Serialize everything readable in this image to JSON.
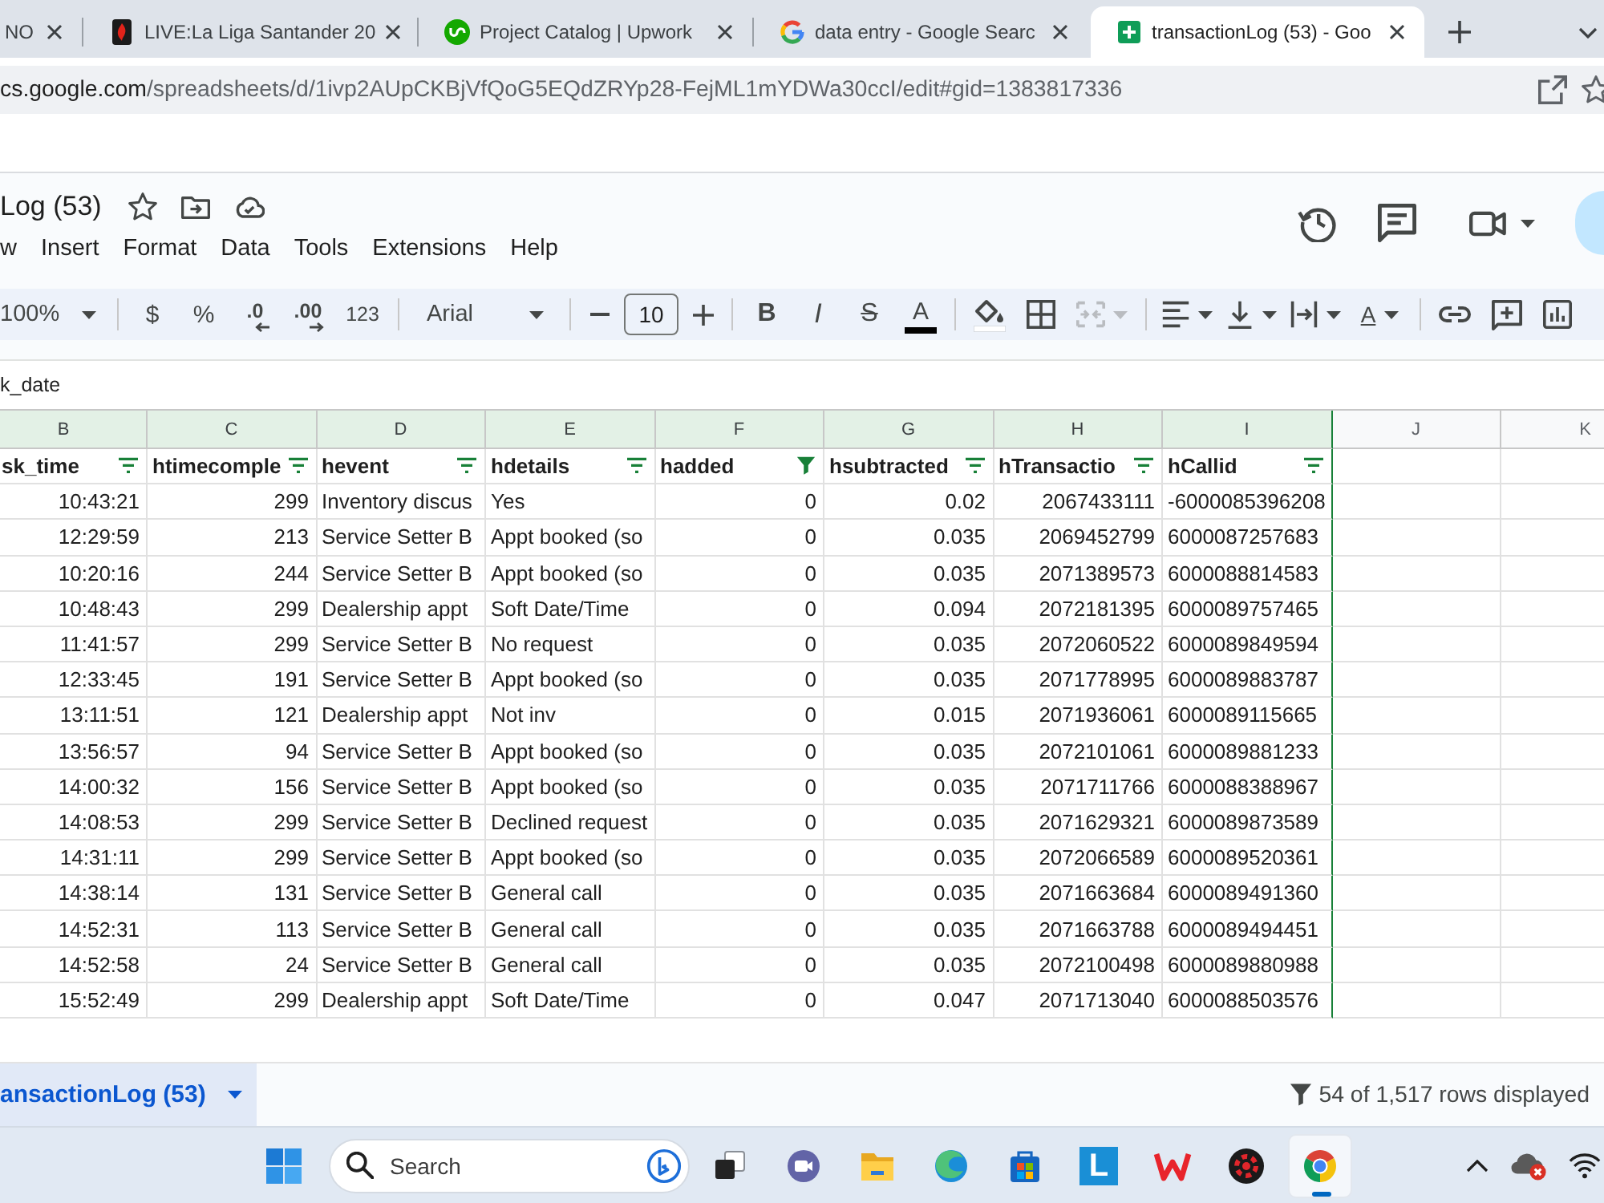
{
  "browser": {
    "tabs": [
      {
        "title": "NO",
        "selected": false
      },
      {
        "title": "LIVE:La Liga Santander 20",
        "selected": false
      },
      {
        "title": "Project Catalog | Upwork",
        "selected": false
      },
      {
        "title": "data entry - Google Searc",
        "selected": false
      },
      {
        "title": "transactionLog (53) - Goo",
        "selected": true
      }
    ],
    "url": {
      "host": "cs.google.com",
      "path": "/spreadsheets/d/1ivp2AUpCKBjVfQoG5EQdZRYp28-FejML1mYDWa30ccI/edit#gid=1383817336"
    }
  },
  "document": {
    "title": "Log (53)",
    "menu": [
      "w",
      "Insert",
      "Format",
      "Data",
      "Tools",
      "Extensions",
      "Help"
    ]
  },
  "toolbar": {
    "zoom": "100%",
    "currency": "$",
    "percent": "%",
    "decrease_decimals": ".0",
    "increase_decimals": ".00",
    "number_format": "123",
    "font": "Arial",
    "font_size": "10",
    "bold": "B",
    "italic": "I",
    "strikethrough": "S",
    "text_color": "A",
    "merge_disabled": true,
    "text_rotation": "A"
  },
  "formula_bar": {
    "value": "k_date"
  },
  "grid": {
    "columns": [
      {
        "letter": "B",
        "filtered": true,
        "heading": "sk_time",
        "filter_active": false,
        "numeric": true
      },
      {
        "letter": "C",
        "filtered": true,
        "heading": "htimecomple",
        "filter_active": false,
        "numeric": true
      },
      {
        "letter": "D",
        "filtered": true,
        "heading": "hevent",
        "filter_active": false,
        "numeric": false
      },
      {
        "letter": "E",
        "filtered": true,
        "heading": "hdetails",
        "filter_active": false,
        "numeric": false
      },
      {
        "letter": "F",
        "filtered": true,
        "heading": "hadded",
        "filter_active": true,
        "numeric": true
      },
      {
        "letter": "G",
        "filtered": true,
        "heading": "hsubtracted",
        "filter_active": false,
        "numeric": true
      },
      {
        "letter": "H",
        "filtered": true,
        "heading": "hTransactio",
        "filter_active": false,
        "numeric": true
      },
      {
        "letter": "I",
        "filtered": true,
        "heading": "hCallid",
        "filter_active": false,
        "numeric": false
      },
      {
        "letter": "J",
        "filtered": false
      },
      {
        "letter": "K",
        "filtered": false
      }
    ],
    "rows": [
      [
        "10:43:21",
        "299",
        "Inventory discus",
        "Yes",
        "0",
        "0.02",
        "2067433111",
        "-6000085396208"
      ],
      [
        "12:29:59",
        "213",
        "Service Setter B",
        "Appt booked (so",
        "0",
        "0.035",
        "2069452799",
        "6000087257683"
      ],
      [
        "10:20:16",
        "244",
        "Service Setter B",
        "Appt booked (so",
        "0",
        "0.035",
        "2071389573",
        "6000088814583"
      ],
      [
        "10:48:43",
        "299",
        "Dealership appt",
        "Soft Date/Time",
        "0",
        "0.094",
        "2072181395",
        "6000089757465"
      ],
      [
        "11:41:57",
        "299",
        "Service Setter B",
        "No request",
        "0",
        "0.035",
        "2072060522",
        "6000089849594"
      ],
      [
        "12:33:45",
        "191",
        "Service Setter B",
        "Appt booked (so",
        "0",
        "0.035",
        "2071778995",
        "6000089883787"
      ],
      [
        "13:11:51",
        "121",
        "Dealership appt",
        "Not inv",
        "0",
        "0.015",
        "2071936061",
        "6000089115665"
      ],
      [
        "13:56:57",
        "94",
        "Service Setter B",
        "Appt booked (so",
        "0",
        "0.035",
        "2072101061",
        "6000089881233"
      ],
      [
        "14:00:32",
        "156",
        "Service Setter B",
        "Appt booked (so",
        "0",
        "0.035",
        "2071711766",
        "6000088388967"
      ],
      [
        "14:08:53",
        "299",
        "Service Setter B",
        "Declined request",
        "0",
        "0.035",
        "2071629321",
        "6000089873589"
      ],
      [
        "14:31:11",
        "299",
        "Service Setter B",
        "Appt booked (so",
        "0",
        "0.035",
        "2072066589",
        "6000089520361"
      ],
      [
        "14:38:14",
        "131",
        "Service Setter B",
        "General call",
        "0",
        "0.035",
        "2071663684",
        "6000089491360"
      ],
      [
        "14:52:31",
        "113",
        "Service Setter B",
        "General call",
        "0",
        "0.035",
        "2071663788",
        "6000089494451"
      ],
      [
        "14:52:58",
        "24",
        "Service Setter B",
        "General call",
        "0",
        "0.035",
        "2072100498",
        "6000089880988"
      ],
      [
        "15:52:49",
        "299",
        "Dealership appt",
        "Soft Date/Time",
        "0",
        "0.047",
        "2071713040",
        "6000088503576"
      ]
    ]
  },
  "sheet_tabs": [
    {
      "label": "ansactionLog (53)",
      "selected": true
    }
  ],
  "status": "54 of 1,517 rows displayed",
  "taskbar": {
    "search": {
      "placeholder": "Search"
    },
    "apps": [
      {
        "selected": false
      },
      {
        "selected": false
      },
      {
        "selected": false
      },
      {
        "selected": false
      },
      {
        "selected": false
      },
      {
        "label": "L",
        "selected": false
      },
      {
        "selected": false
      },
      {
        "selected": false
      },
      {
        "selected": true
      }
    ]
  }
}
